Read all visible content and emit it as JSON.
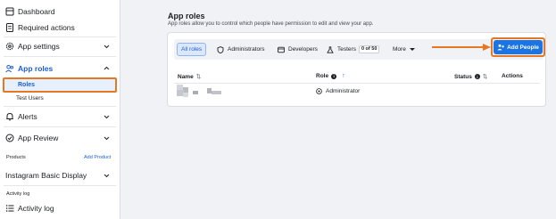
{
  "sidebar": {
    "dashboard": "Dashboard",
    "required_actions": "Required actions",
    "app_settings": "App settings",
    "app_roles": "App roles",
    "roles": "Roles",
    "test_users": "Test Users",
    "alerts": "Alerts",
    "app_review": "App Review",
    "products_label": "Products",
    "add_product": "Add Product",
    "instagram": "Instagram Basic Display",
    "activity_label": "Activity log",
    "activity_log": "Activity log"
  },
  "main": {
    "title": "App roles",
    "subtitle": "App roles allow you to control which people have permission to edit and view your app.",
    "tabs": {
      "all_roles": "All roles",
      "administrators": "Administrators",
      "developers": "Developers",
      "testers": "Testers",
      "testers_count": "0 of 50",
      "more": "More"
    },
    "add_people": "Add People",
    "table": {
      "headers": {
        "name": "Name",
        "role": "Role",
        "status": "Status",
        "actions": "Actions"
      },
      "rows": [
        {
          "role": "Administrator"
        }
      ]
    }
  },
  "colors": {
    "accent": "#1b74e4",
    "highlight": "#e87722"
  }
}
